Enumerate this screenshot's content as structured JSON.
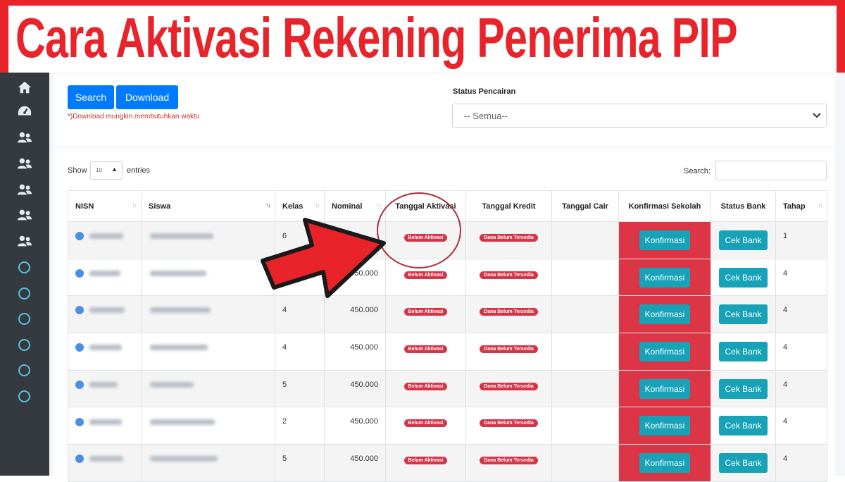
{
  "banner": {
    "title": "Cara Aktivasi Rekening Penerima PIP"
  },
  "sidebar": {
    "icons": [
      "home-icon",
      "dashboard-icon",
      "users-icon",
      "users-icon",
      "users-icon",
      "users-icon",
      "users-icon"
    ],
    "circles": 6
  },
  "filter": {
    "search_label": "Search",
    "download_label": "Download",
    "download_note": "*)Download mungkin membutuhkan waktu",
    "status_label": "Status Pencairan",
    "status_value": "-- Semua--"
  },
  "table_controls": {
    "show_label": "Show",
    "show_value": "10",
    "entries_label": "entries",
    "search_label": "Search:"
  },
  "table": {
    "columns": [
      "NISN",
      "Siswa",
      "Kelas",
      "Nominal",
      "Tanggal Aktivasi",
      "Tanggal Kredit",
      "Tanggal Cair",
      "Konfirmasi Sekolah",
      "Status Bank",
      "Tahap"
    ],
    "rows": [
      {
        "kelas": "6",
        "nominal": "",
        "aktivasi": "Belum Aktivasi",
        "kredit": "Dana Belum Tersedia",
        "cair": "",
        "konfirmasi": "Konfirmasi",
        "bank": "Cek Bank",
        "tahap": "1"
      },
      {
        "kelas": "",
        "nominal": "50.000",
        "aktivasi": "Belum Aktivasi",
        "kredit": "Dana Belum Tersedia",
        "cair": "",
        "konfirmasi": "Konfirmasi",
        "bank": "Cek Bank",
        "tahap": "4"
      },
      {
        "kelas": "4",
        "nominal": "450.000",
        "aktivasi": "Belum Aktivasi",
        "kredit": "Dana Belum Tersedia",
        "cair": "",
        "konfirmasi": "Konfirmasi",
        "bank": "Cek Bank",
        "tahap": "4"
      },
      {
        "kelas": "4",
        "nominal": "450.000",
        "aktivasi": "Belum Aktivasi",
        "kredit": "Dana Belum Tersedia",
        "cair": "",
        "konfirmasi": "Konfirmasi",
        "bank": "Cek Bank",
        "tahap": "4"
      },
      {
        "kelas": "5",
        "nominal": "450.000",
        "aktivasi": "Belum Aktivasi",
        "kredit": "Dana Belum Tersedia",
        "cair": "",
        "konfirmasi": "Konfirmasi",
        "bank": "Cek Bank",
        "tahap": "4"
      },
      {
        "kelas": "2",
        "nominal": "450.000",
        "aktivasi": "Belum Aktivasi",
        "kredit": "Dana Belum Tersedia",
        "cair": "",
        "konfirmasi": "Konfirmasi",
        "bank": "Cek Bank",
        "tahap": "4"
      },
      {
        "kelas": "5",
        "nominal": "450.000",
        "aktivasi": "Belum Aktivasi",
        "kredit": "Dana Belum Tersedia",
        "cair": "",
        "konfirmasi": "Konfirmasi",
        "bank": "Cek Bank",
        "tahap": "4"
      }
    ]
  },
  "colors": {
    "banner_red": "#e8232a",
    "primary_blue": "#007bff",
    "danger_red": "#dc3545",
    "info_teal": "#17a2b8",
    "sidebar_dark": "#343a40"
  }
}
